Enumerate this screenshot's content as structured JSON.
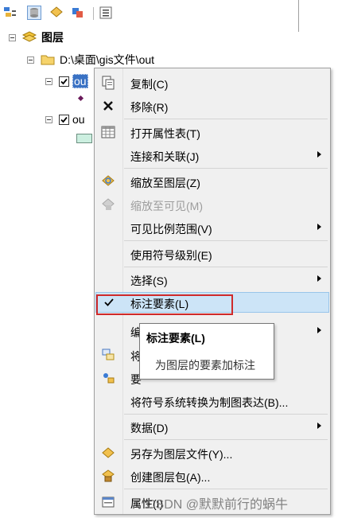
{
  "toc": {
    "root_layer_label": "图层",
    "folder_path": "D:\\桌面\\gis文件\\out",
    "layer1_label": "ou",
    "layer2_label": "ou"
  },
  "menu": {
    "copy": "复制(C)",
    "remove": "移除(R)",
    "open_attr_table": "打开属性表(T)",
    "joins_relates": "连接和关联(J)",
    "zoom_to_layer": "缩放至图层(Z)",
    "zoom_to_visible": "缩放至可见(M)",
    "visible_scale_range": "可见比例范围(V)",
    "use_symbol_levels": "使用符号级别(E)",
    "selection": "选择(S)",
    "label_features": "标注要素(L)",
    "edit_features_partial": "编",
    "convert_labels_partial": "将",
    "convert_features_partial": "要",
    "convert_symbology": "将符号系统转换为制图表达(B)...",
    "data": "数据(D)",
    "save_as_layer_file": "另存为图层文件(Y)...",
    "create_layer_package": "创建图层包(A)...",
    "properties_partial": "属性(I)"
  },
  "tooltip": {
    "title": "标注要素(L)",
    "description": "为图层的要素加标注"
  },
  "watermark": "CSDN @默默前行的蜗牛",
  "colors": {
    "highlight": "#cce4f7",
    "highlight_border": "#99c5ea",
    "annotation_box": "#cf2a2a",
    "menu_bg": "#f0f0f0"
  }
}
